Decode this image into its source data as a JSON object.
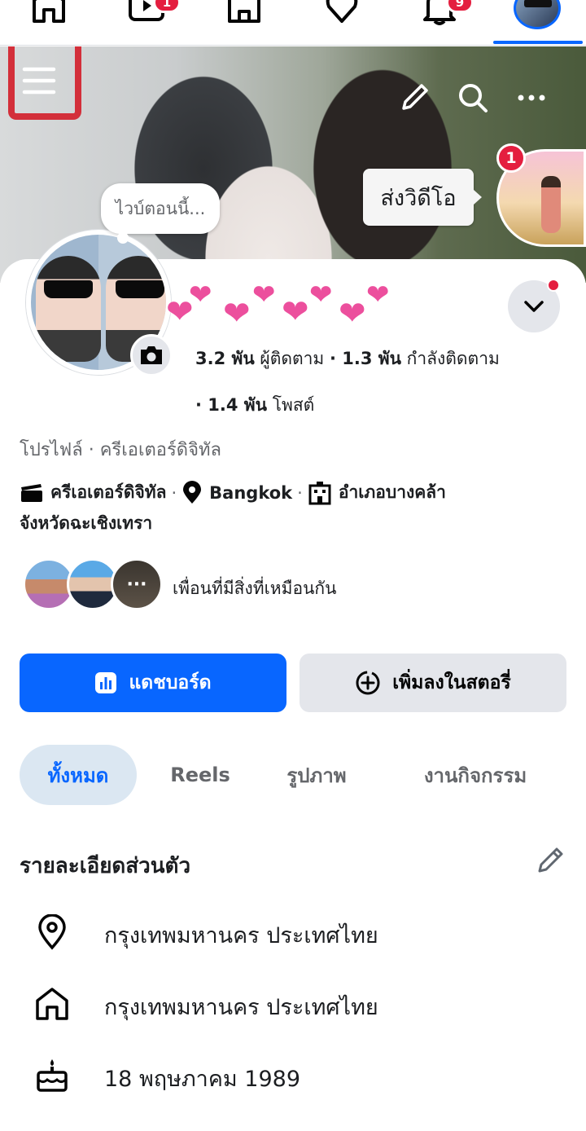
{
  "nav": {
    "video_badge": "1",
    "notifications_badge": "9"
  },
  "cover": {
    "send_video_label": "ส่งวิดีโอ",
    "story_badge": "1"
  },
  "profile": {
    "thought_placeholder": "ไวบ์ตอนนี้...",
    "followers_count": "3.2 พัน",
    "followers_label": "ผู้ติดตาม",
    "following_count": "1.3 พัน",
    "following_label": "กำลังติดตาม",
    "posts_count": "1.4 พัน",
    "posts_label": "โพสต์",
    "subtitle": "โปรไฟล์ · ครีเอเตอร์ดิจิทัล",
    "category": "ครีเอเตอร์ดิจิทัล",
    "location": "Bangkok",
    "district": "อำเภอบางคล้า",
    "province": "จังหวัดฉะเชิงเทรา",
    "mutual_text": "เพื่อนที่มีสิ่งที่เหมือนกัน",
    "mutual_more": "···"
  },
  "actions": {
    "dashboard_label": "แดชบอร์ด",
    "add_story_label": "เพิ่มลงในสตอรี่"
  },
  "tabs": [
    {
      "label": "ทั้งหมด"
    },
    {
      "label": "Reels"
    },
    {
      "label": "รูปภาพ"
    },
    {
      "label": "งานกิจกรรม"
    }
  ],
  "details": {
    "title": "รายละเอียดส่วนตัว",
    "current_city": "กรุงเทพมหานคร ประเทศไทย",
    "hometown": "กรุงเทพมหานคร ประเทศไทย",
    "birthday": "18 พฤษภาคม  1989"
  },
  "colors": {
    "accent": "#0866ff",
    "badge": "#e41e3f",
    "secondary_button": "#e4e6eb",
    "active_tab_bg": "#dbe7f2"
  }
}
